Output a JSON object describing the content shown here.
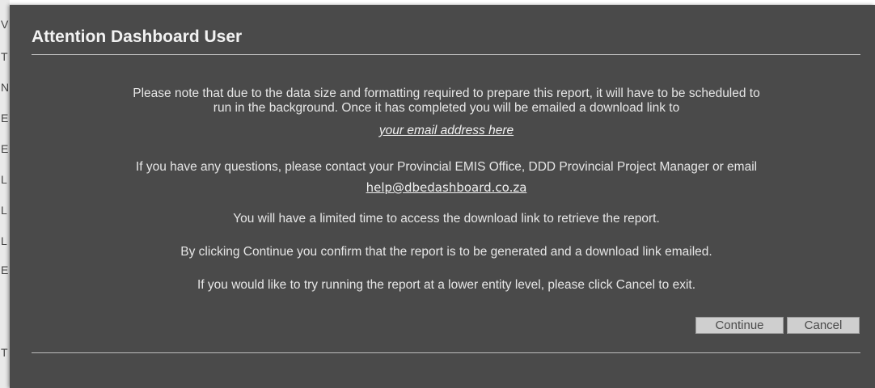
{
  "dialog": {
    "title": "Attention Dashboard User",
    "message_line1": "Please note that due to the data size and formatting required to prepare this report, it will have to be scheduled to",
    "message_line2": "run in the background. Once it has completed you will be emailed a download link to",
    "email_placeholder": "your email address here",
    "contact_text": "If you have any questions, please contact your Provincial EMIS Office, DDD Provincial Project Manager or email",
    "help_email": "help@dbedashboard.co.za",
    "limited_time_text": "You will have a limited time to access the download link to retrieve the report.",
    "confirm_text": "By clicking Continue you confirm that the report is to be generated and a download link emailed.",
    "lower_level_text": "If you would like to try running the report at a lower entity level, please click Cancel to exit.",
    "continue_label": "Continue",
    "cancel_label": "Cancel"
  },
  "background_page": {
    "letters": [
      "V",
      "T",
      "N",
      "E",
      "E",
      "L",
      "L",
      "L",
      "E",
      "T"
    ]
  }
}
